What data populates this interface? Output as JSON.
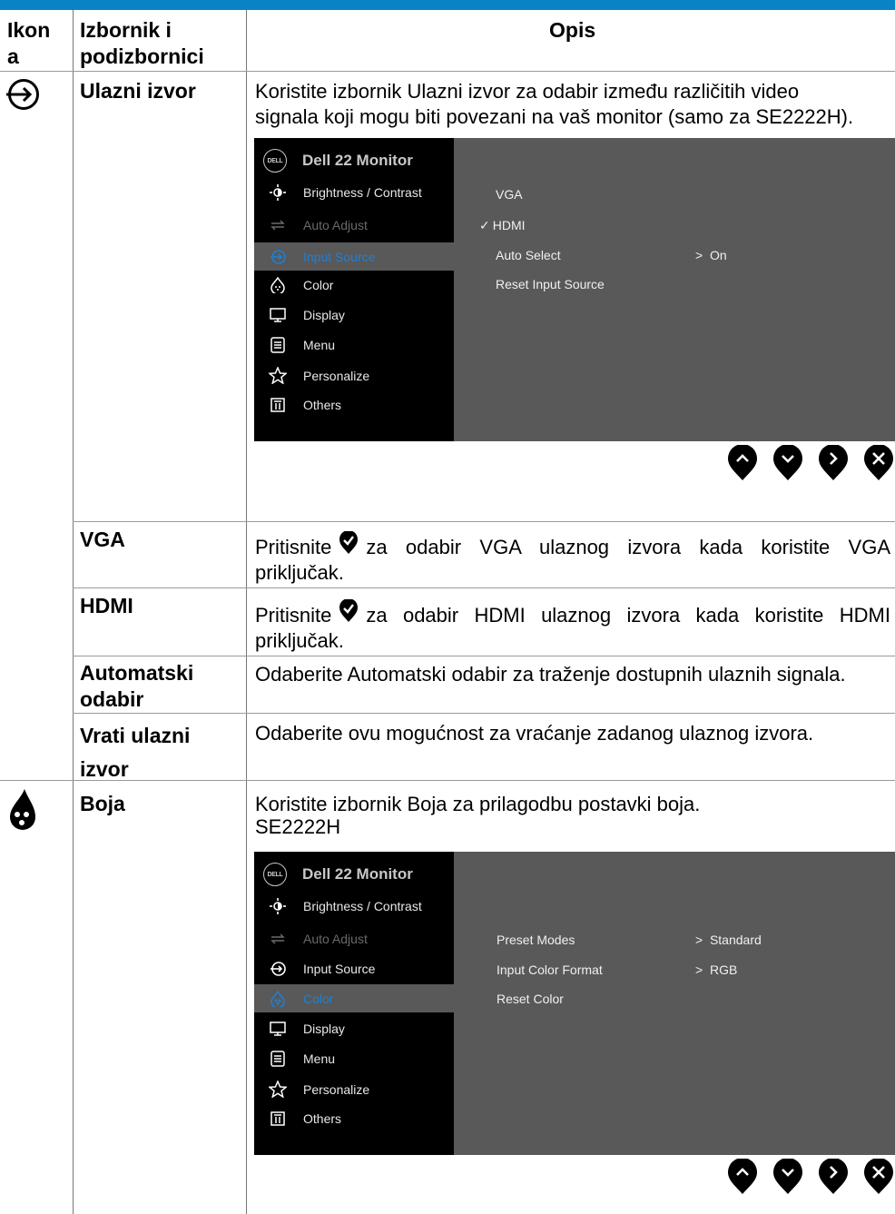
{
  "header": {
    "col1": "Ikon",
    "col1b": "a",
    "col2": "Izbornik i",
    "col2b": "podizbornici",
    "col3": "Opis"
  },
  "input_section": {
    "title": "Ulazni izvor",
    "desc_line1": "Koristite izbornik Ulazni izvor za odabir između različitih video",
    "desc_line2": "signala koji mogu biti povezani na vaš monitor (samo za SE2222H).",
    "icon": "input-source-icon"
  },
  "osd1": {
    "model": "Dell 22 Monitor",
    "logo": "DELL",
    "menu": [
      "Brightness / Contrast",
      "Auto Adjust",
      "Input Source",
      "Color",
      "Display",
      "Menu",
      "Personalize",
      "Others"
    ],
    "selected": "Input Source",
    "options": [
      {
        "label": "VGA",
        "check": "",
        "value": ""
      },
      {
        "label": "HDMI",
        "check": "✓",
        "value": ""
      },
      {
        "label": "Auto Select",
        "check": "",
        "value": ">  On"
      },
      {
        "label": "Reset Input Source",
        "check": "",
        "value": ""
      }
    ]
  },
  "subrows": [
    {
      "name": "VGA",
      "desc_pre": "Pritisnite",
      "desc_post": "za odabir VGA ulaznog izvora kada koristite VGA",
      "desc_line2": "priključak."
    },
    {
      "name": "HDMI",
      "desc_pre": "Pritisnite",
      "desc_post": "za odabir HDMI ulaznog izvora kada koristite HDMI",
      "desc_line2": "priključak."
    }
  ],
  "auto_select": {
    "name1": "Automatski",
    "name2": "odabir",
    "desc": "Odaberite Automatski odabir za traženje dostupnih ulaznih signala."
  },
  "reset_input": {
    "name1": "Vrati ulazni",
    "name2": "izvor",
    "desc": "Odaberite ovu mogućnost za vraćanje zadanog ulaznog izvora."
  },
  "color_section": {
    "title": "Boja",
    "desc_line1": "Koristite izbornik Boja za prilagodbu postavki boja.",
    "desc_line2": "SE2222H",
    "icon": "color-drop-icon"
  },
  "osd2": {
    "model": "Dell 22 Monitor",
    "logo": "DELL",
    "menu": [
      "Brightness / Contrast",
      "Auto Adjust",
      "Input Source",
      "Color",
      "Display",
      "Menu",
      "Personalize",
      "Others"
    ],
    "selected": "Color",
    "options": [
      {
        "label": "Preset Modes",
        "value": ">  Standard"
      },
      {
        "label": "Input Color Format",
        "value": ">  RGB"
      },
      {
        "label": "Reset Color",
        "value": ""
      }
    ]
  },
  "nav_buttons": [
    "up-arrow-icon",
    "down-arrow-icon",
    "right-arrow-icon",
    "exit-icon"
  ],
  "colors": {
    "accent": "#0a83c6",
    "osd_bg": "#595959",
    "osd_menu": "#000000",
    "osd_selected": "#1f7fd4"
  }
}
